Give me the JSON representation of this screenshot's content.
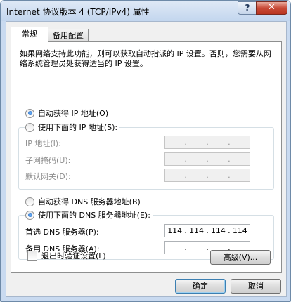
{
  "window": {
    "title": "Internet 协议版本 4 (TCP/IPv4) 属性",
    "help_label": "?",
    "close_label": "✕"
  },
  "tabs": [
    {
      "label": "常规",
      "active": true
    },
    {
      "label": "备用配置",
      "active": false
    }
  ],
  "description": "如果网络支持此功能，则可以获取自动指派的 IP 设置。否则，您需要从网络系统管理员处获得适当的 IP 设置。",
  "ip_section": {
    "auto_label": "自动获得 IP 地址(O)",
    "auto_checked": true,
    "manual_label": "使用下面的 IP 地址(S):",
    "manual_checked": false,
    "fields": [
      {
        "label": "IP 地址(I):",
        "value": [
          "",
          "",
          "",
          ""
        ]
      },
      {
        "label": "子网掩码(U):",
        "value": [
          "",
          "",
          "",
          ""
        ]
      },
      {
        "label": "默认网关(D):",
        "value": [
          "",
          "",
          "",
          ""
        ]
      }
    ]
  },
  "dns_section": {
    "auto_label": "自动获得 DNS 服务器地址(B)",
    "auto_checked": false,
    "manual_label": "使用下面的 DNS 服务器地址(E):",
    "manual_checked": true,
    "fields": [
      {
        "label": "首选 DNS 服务器(P):",
        "value": [
          "114",
          "114",
          "114",
          "114"
        ]
      },
      {
        "label": "备用 DNS 服务器(A):",
        "value": [
          "",
          "",
          "",
          ""
        ]
      }
    ]
  },
  "validate_checkbox": {
    "label": "退出时验证设置(L)",
    "checked": false
  },
  "buttons": {
    "advanced": "高级(V)...",
    "ok": "确定",
    "cancel": "取消"
  }
}
